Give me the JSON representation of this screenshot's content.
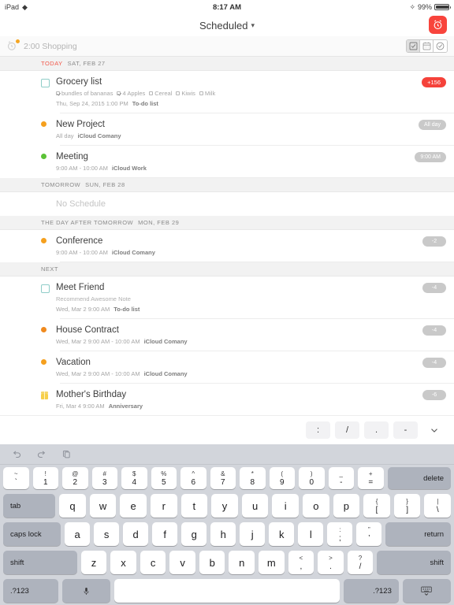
{
  "status_bar": {
    "device": "iPad",
    "wifi_icon": "wifi-icon",
    "time": "8:17 AM",
    "bluetooth_icon": "bluetooth-icon",
    "battery_percent": "99%"
  },
  "nav_bar": {
    "title": "Scheduled",
    "chevron": "∨",
    "alarm_button_icon": "alarm-clock-icon"
  },
  "reminder_bar": {
    "icon": "alarm-clock-badge-icon",
    "text": "2:00 Shopping",
    "segments": [
      {
        "icon": "checkbox-square-icon",
        "active": true
      },
      {
        "icon": "calendar-icon",
        "active": false
      },
      {
        "icon": "check-circle-icon",
        "active": false
      }
    ]
  },
  "sections": [
    {
      "label": "TODAY",
      "date": "SAT, FEB 27",
      "is_today": true,
      "rows": [
        {
          "marker": "checkbox",
          "title": "Grocery list",
          "checklist": [
            {
              "label": "bundles of bananas",
              "checked": true
            },
            {
              "label": "4 Apples",
              "checked": true
            },
            {
              "label": "Cereal",
              "checked": false
            },
            {
              "label": "Kiwis",
              "checked": false
            },
            {
              "label": "Milk",
              "checked": false
            }
          ],
          "meta": "Thu, Sep 24, 2015 1:00 PM",
          "meta_bold": "To-do list",
          "pill": "+156",
          "pill_style": "red"
        },
        {
          "marker": "dot",
          "marker_color": "#f5a01e",
          "title": "New Project",
          "meta": "All day",
          "meta_bold": "iCloud Comany",
          "pill": "All day",
          "pill_style": "grey"
        },
        {
          "marker": "dot",
          "marker_color": "#5bc236",
          "title": "Meeting",
          "meta": "9:00 AM - 10:00 AM",
          "meta_bold": "iCloud Work",
          "pill": "9:00 AM",
          "pill_style": "grey"
        }
      ]
    },
    {
      "label": "TOMORROW",
      "date": "SUN, FEB 28",
      "is_today": false,
      "empty_text": "No Schedule",
      "rows": []
    },
    {
      "label": "THE DAY AFTER TOMORROW",
      "date": "MON, FEB 29",
      "is_today": false,
      "rows": [
        {
          "marker": "dot",
          "marker_color": "#f5a01e",
          "title": "Conference",
          "meta": "9:00 AM - 10:00 AM",
          "meta_bold": "iCloud Comany",
          "pill": "-2",
          "pill_style": "grey"
        }
      ]
    },
    {
      "label": "NEXT",
      "date": "",
      "is_today": false,
      "rows": [
        {
          "marker": "checkbox",
          "title": "Meet Friend",
          "note": "Recommend Awesome Note",
          "meta": "Wed, Mar 2 9:00 AM",
          "meta_bold": "To-do list",
          "pill": "-4",
          "pill_style": "grey"
        },
        {
          "marker": "dot",
          "marker_color": "#f08a1e",
          "title": "House Contract",
          "meta": "Wed, Mar 2 9:00 AM - 10:00 AM",
          "meta_bold": "iCloud Comany",
          "pill": "-4",
          "pill_style": "grey"
        },
        {
          "marker": "dot",
          "marker_color": "#f5a01e",
          "title": "Vacation",
          "meta": "Wed, Mar 2 9:00 AM - 10:00 AM",
          "meta_bold": "iCloud Comany",
          "pill": "-4",
          "pill_style": "grey"
        },
        {
          "marker": "gift",
          "title": "Mother's Birthday",
          "meta": "Fri, Mar 4 9:00 AM",
          "meta_bold": "Anniversary",
          "pill": "-6",
          "pill_style": "grey"
        }
      ]
    }
  ],
  "shortcut_bar": {
    "keys": [
      ":",
      "/",
      ".",
      "-"
    ],
    "dismiss_icon": "chevron-down-icon"
  },
  "keyboard": {
    "tools": [
      "undo-icon",
      "redo-icon",
      "paste-icon"
    ],
    "row_num": [
      {
        "up": "~",
        "lo": "`"
      },
      {
        "up": "!",
        "lo": "1"
      },
      {
        "up": "@",
        "lo": "2"
      },
      {
        "up": "#",
        "lo": "3"
      },
      {
        "up": "$",
        "lo": "4"
      },
      {
        "up": "%",
        "lo": "5"
      },
      {
        "up": "^",
        "lo": "6"
      },
      {
        "up": "&",
        "lo": "7"
      },
      {
        "up": "*",
        "lo": "8"
      },
      {
        "up": "(",
        "lo": "9"
      },
      {
        "up": ")",
        "lo": "0"
      },
      {
        "up": "_",
        "lo": "-"
      },
      {
        "up": "+",
        "lo": "="
      }
    ],
    "delete_label": "delete",
    "tab_label": "tab",
    "row_q": [
      "q",
      "w",
      "e",
      "r",
      "t",
      "y",
      "u",
      "i",
      "o",
      "p"
    ],
    "row_q_dual": [
      {
        "up": "{",
        "lo": "["
      },
      {
        "up": "}",
        "lo": "]"
      },
      {
        "up": "|",
        "lo": "\\"
      }
    ],
    "caps_label": "caps lock",
    "row_a": [
      "a",
      "s",
      "d",
      "f",
      "g",
      "h",
      "j",
      "k",
      "l"
    ],
    "row_a_dual": [
      {
        "up": ":",
        "lo": ";"
      },
      {
        "up": "”",
        "lo": "’"
      }
    ],
    "return_label": "return",
    "shift_left_label": "shift",
    "row_z": [
      "z",
      "x",
      "c",
      "v",
      "b",
      "n",
      "m"
    ],
    "row_z_dual": [
      {
        "up": "<",
        "lo": ","
      },
      {
        "up": ">",
        "lo": "."
      },
      {
        "up": "?",
        "lo": "/"
      }
    ],
    "shift_right_label": "shift",
    "num_left_label": ".?123",
    "mic_icon": "microphone-icon",
    "space_label": "",
    "num_right_label": ".?123",
    "hide_keyboard_icon": "hide-keyboard-icon"
  },
  "colors": {
    "accent_red": "#f8443c",
    "today_red": "#f2594b",
    "pill_grey": "#c9c9c9",
    "badge_yellow": "#f5a623",
    "checkbox_teal": "#8fcdc8"
  }
}
